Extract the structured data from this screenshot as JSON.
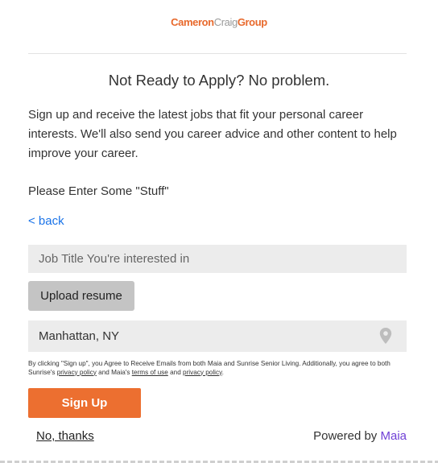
{
  "logo": {
    "part1": "Cameron",
    "part2": "Craig",
    "part3": "Group"
  },
  "title": "Not Ready to Apply? No problem.",
  "intro": "Sign up and receive the latest jobs that fit your personal career interests. We'll also send you career advice and other content to help improve your career.",
  "prompt": "Please Enter Some \"Stuff\"",
  "back_link": "< back",
  "job_title_field": {
    "placeholder": "Job Title You're interested in",
    "value": ""
  },
  "upload_button": "Upload resume",
  "location_field": {
    "value": "Manhattan, NY",
    "icon": "location-pin-icon"
  },
  "legal": {
    "text1": "By clicking \"Sign up\", you Agree to Receive Emails from both Maia and Sunrise Senior Living. Additionally, you agree to both Sunrise's ",
    "link1": "privacy policy",
    "text2": " and Maia's ",
    "link2": "terms of use",
    "text3": " and ",
    "link3": "privacy policy",
    "text4": "."
  },
  "signup_button": "Sign Up",
  "no_thanks": "No, thanks",
  "powered_by": {
    "prefix": "Powered by ",
    "brand": "Maia"
  },
  "colors": {
    "accent_orange": "#ec6f30",
    "link_blue": "#1a73e8",
    "maia_purple": "#6f3fd6",
    "field_bg": "#ececec"
  }
}
